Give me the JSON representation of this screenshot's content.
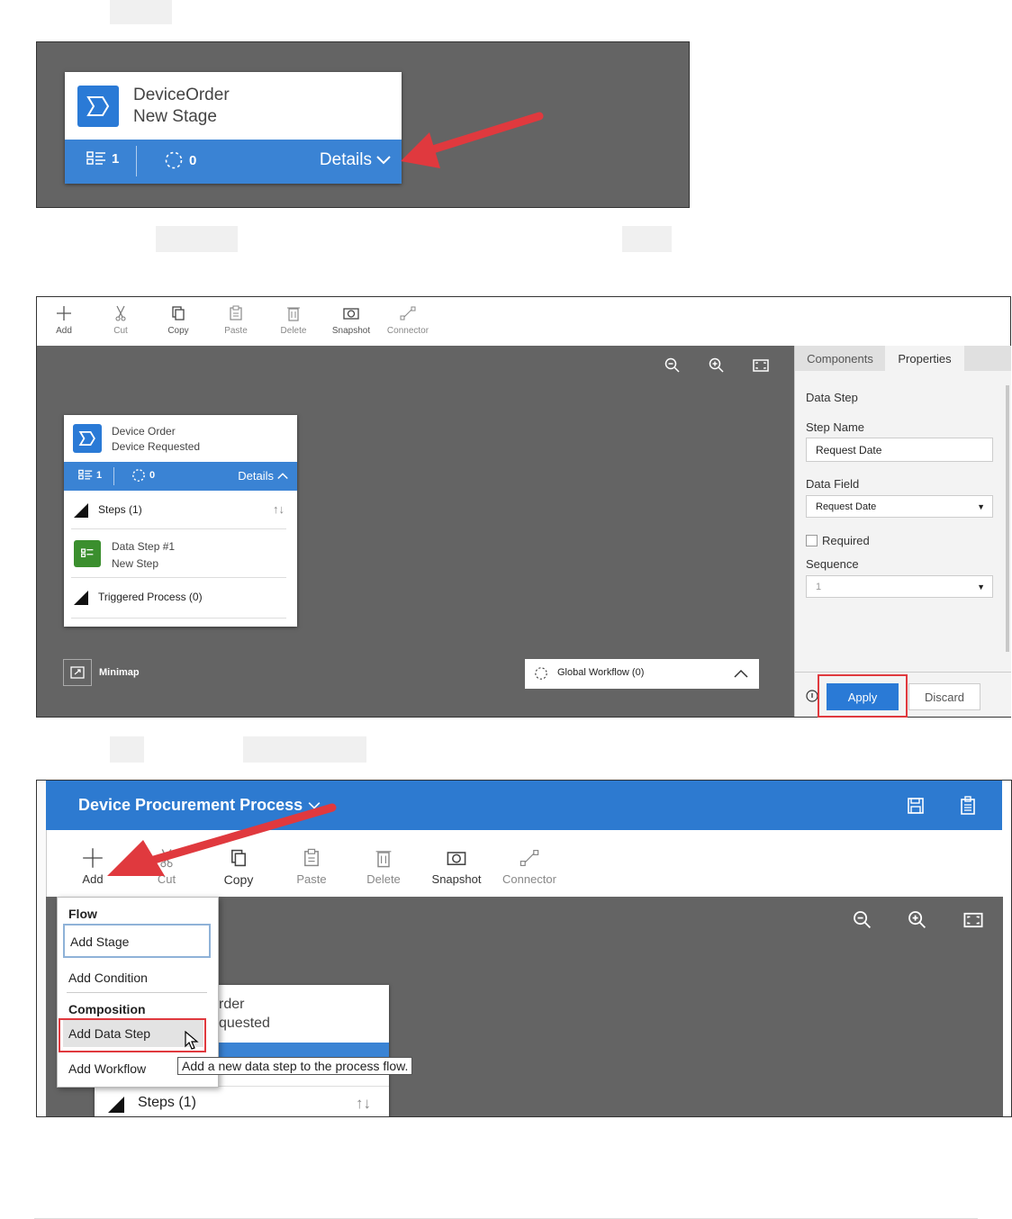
{
  "panel1": {
    "stage_title": "DeviceOrder",
    "stage_subtitle": "New Stage",
    "steps_count": "1",
    "workflow_count": "0",
    "details_label": "Details"
  },
  "panel2": {
    "toolbar": [
      {
        "label": "Add",
        "icon": "plus-icon"
      },
      {
        "label": "Cut",
        "icon": "scissors-icon"
      },
      {
        "label": "Copy",
        "icon": "copy-icon"
      },
      {
        "label": "Paste",
        "icon": "paste-icon"
      },
      {
        "label": "Delete",
        "icon": "trash-icon"
      },
      {
        "label": "Snapshot",
        "icon": "camera-icon"
      },
      {
        "label": "Connector",
        "icon": "connector-icon"
      }
    ],
    "stage_title": "Device Order",
    "stage_subtitle": "Device Requested",
    "steps_count": "1",
    "workflow_count": "0",
    "details_label": "Details",
    "steps_header": "Steps (1)",
    "data_step_title": "Data Step #1",
    "data_step_subtitle": "New Step",
    "triggered_header": "Triggered Process (0)",
    "minimap_label": "Minimap",
    "global_workflow_label": "Global Workflow (0)",
    "tabs": {
      "components": "Components",
      "properties": "Properties"
    },
    "properties": {
      "section_title": "Data Step",
      "step_name_label": "Step Name",
      "step_name_value": "Request Date",
      "data_field_label": "Data Field",
      "data_field_value": "Request Date",
      "required_label": "Required",
      "sequence_label": "Sequence",
      "sequence_value": "1",
      "apply_label": "Apply",
      "discard_label": "Discard"
    }
  },
  "panel3": {
    "process_title": "Device Procurement Process",
    "toolbar": [
      {
        "label": "Add",
        "icon": "plus-icon"
      },
      {
        "label": "Cut",
        "icon": "scissors-icon"
      },
      {
        "label": "Copy",
        "icon": "copy-icon"
      },
      {
        "label": "Paste",
        "icon": "paste-icon"
      },
      {
        "label": "Delete",
        "icon": "trash-icon"
      },
      {
        "label": "Snapshot",
        "icon": "camera-icon"
      },
      {
        "label": "Connector",
        "icon": "connector-icon"
      }
    ],
    "menu": {
      "flow_header": "Flow",
      "add_stage": "Add Stage",
      "add_condition": "Add Condition",
      "composition_header": "Composition",
      "add_data_step": "Add Data Step",
      "add_workflow": "Add Workflow"
    },
    "tooltip": "Add a new data step to the process flow.",
    "stage_title_partial": "rder",
    "stage_subtitle_partial": "quested",
    "steps_header": "Steps (1)"
  },
  "colors": {
    "accent_blue": "#2d7ad0",
    "canvas_gray": "#646464",
    "highlight_red": "#e0393e",
    "green_step": "#3b8f2e"
  }
}
